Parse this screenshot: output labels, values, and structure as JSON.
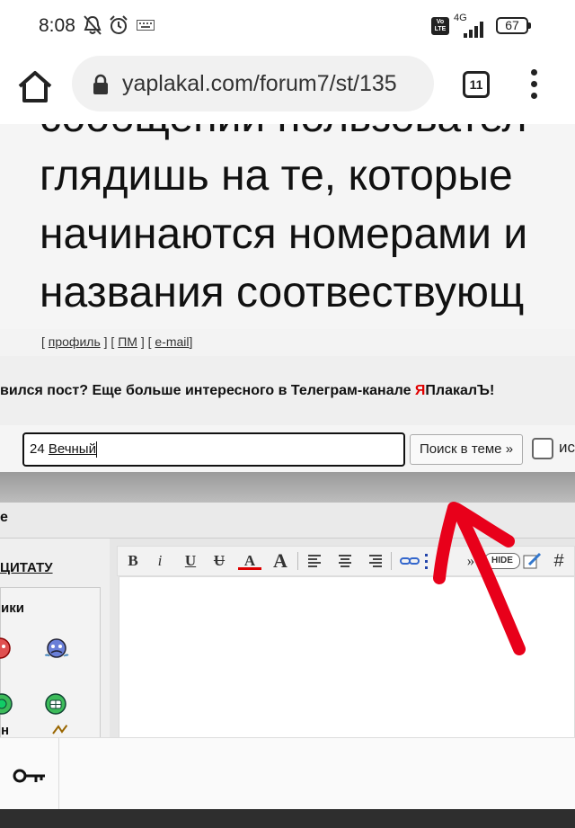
{
  "status": {
    "time": "8:08",
    "network": "4G",
    "volte": "Vo LTE",
    "battery": "67"
  },
  "browser": {
    "url": "yaplakal.com/forum7/st/135",
    "tab_count": "11"
  },
  "post": {
    "lines": [
      "сообщений пользовател",
      "глядишь на те, которые",
      "начинаются номерами и",
      "названия соотвествующ"
    ],
    "links": {
      "profile": "профиль",
      "pm": "ПМ",
      "email": "e-mail"
    }
  },
  "promo": {
    "text_before": "вился пост? Еще больше интересного в Телеграм-канале ",
    "brand_red": "Я",
    "brand_rest": "ПлакалЪ",
    "text_after": "!"
  },
  "search": {
    "value_prefix": "24 ",
    "value_word": "Вечный",
    "button_label": "Поиск в теме »",
    "checkbox_label": "ис"
  },
  "reply": {
    "header": "е",
    "quote_label": "ЦИТАТУ",
    "smiles_title": "ики",
    "smile_fragment": "н",
    "toolbar": {
      "bold": "B",
      "italic": "i",
      "underline": "U",
      "strike": "U",
      "color": "A",
      "size": "A",
      "hide": "HIDE",
      "hash": "#",
      "quote": "»"
    }
  },
  "colors": {
    "promo_accent": "#e00000",
    "annotation_arrow": "#e8001a"
  }
}
